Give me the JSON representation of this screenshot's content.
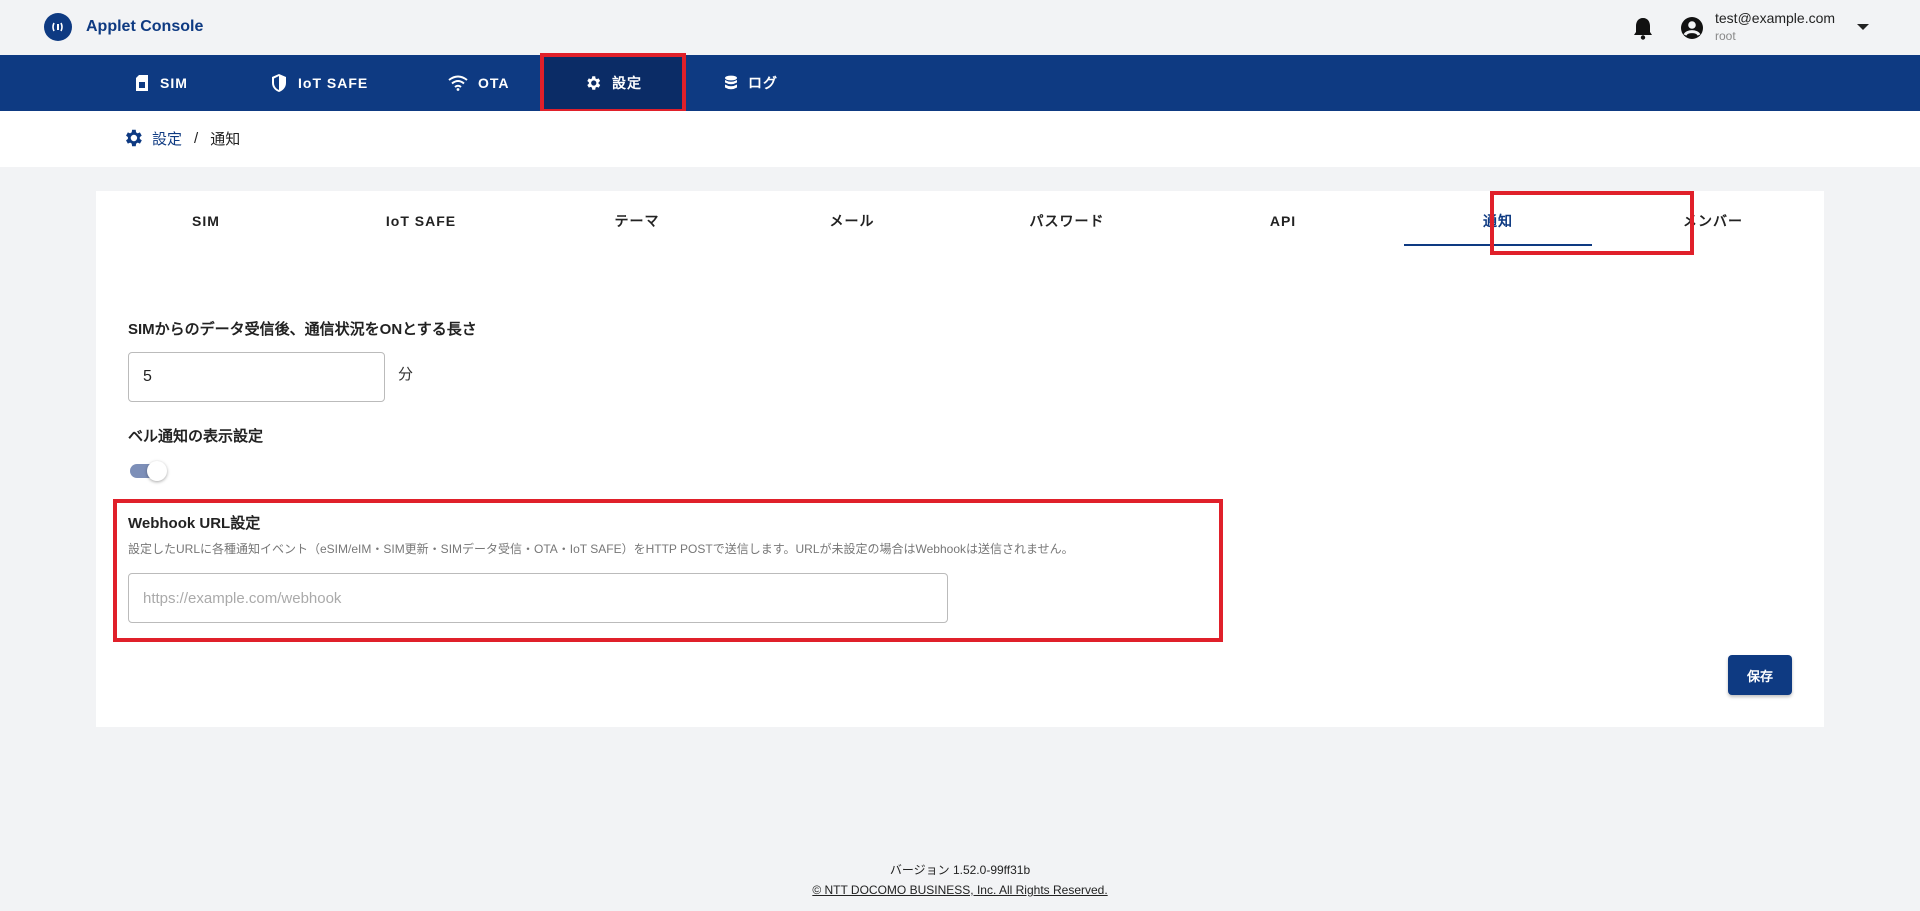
{
  "app": {
    "name": "Applet Console"
  },
  "user": {
    "email": "test@example.com",
    "role": "root"
  },
  "nav": {
    "items": [
      {
        "label": "SIM",
        "icon": "sim-card-icon"
      },
      {
        "label": "IoT SAFE",
        "icon": "shield-icon"
      },
      {
        "label": "OTA",
        "icon": "wifi-icon"
      },
      {
        "label": "設定",
        "icon": "gear-icon",
        "active": true
      },
      {
        "label": "ログ",
        "icon": "database-icon"
      }
    ]
  },
  "breadcrumb": {
    "parent": "設定",
    "separator": "/",
    "current": "通知"
  },
  "tabs": [
    {
      "label": "SIM"
    },
    {
      "label": "IoT SAFE"
    },
    {
      "label": "テーマ"
    },
    {
      "label": "メール"
    },
    {
      "label": "パスワード"
    },
    {
      "label": "API"
    },
    {
      "label": "通知",
      "active": true
    },
    {
      "label": "メンバー"
    }
  ],
  "form": {
    "duration": {
      "label": "SIMからのデータ受信後、通信状況をONとする長さ",
      "value": "5",
      "unit": "分"
    },
    "bell": {
      "label": "ベル通知の表示設定",
      "enabled": true
    },
    "webhook": {
      "label": "Webhook URL設定",
      "description": "設定したURLに各種通知イベント（eSIM/eIM・SIM更新・SIMデータ受信・OTA・IoT SAFE）をHTTP POSTで送信します。URLが未設定の場合はWebhookは送信されません。",
      "value": "",
      "placeholder": "https://example.com/webhook"
    },
    "save_label": "保存"
  },
  "footer": {
    "version": "バージョン 1.52.0-99ff31b",
    "copyright": "© NTT DOCOMO BUSINESS, Inc. All Rights Reserved."
  },
  "colors": {
    "brand": "#0e3a82",
    "highlight": "#e0202a"
  }
}
